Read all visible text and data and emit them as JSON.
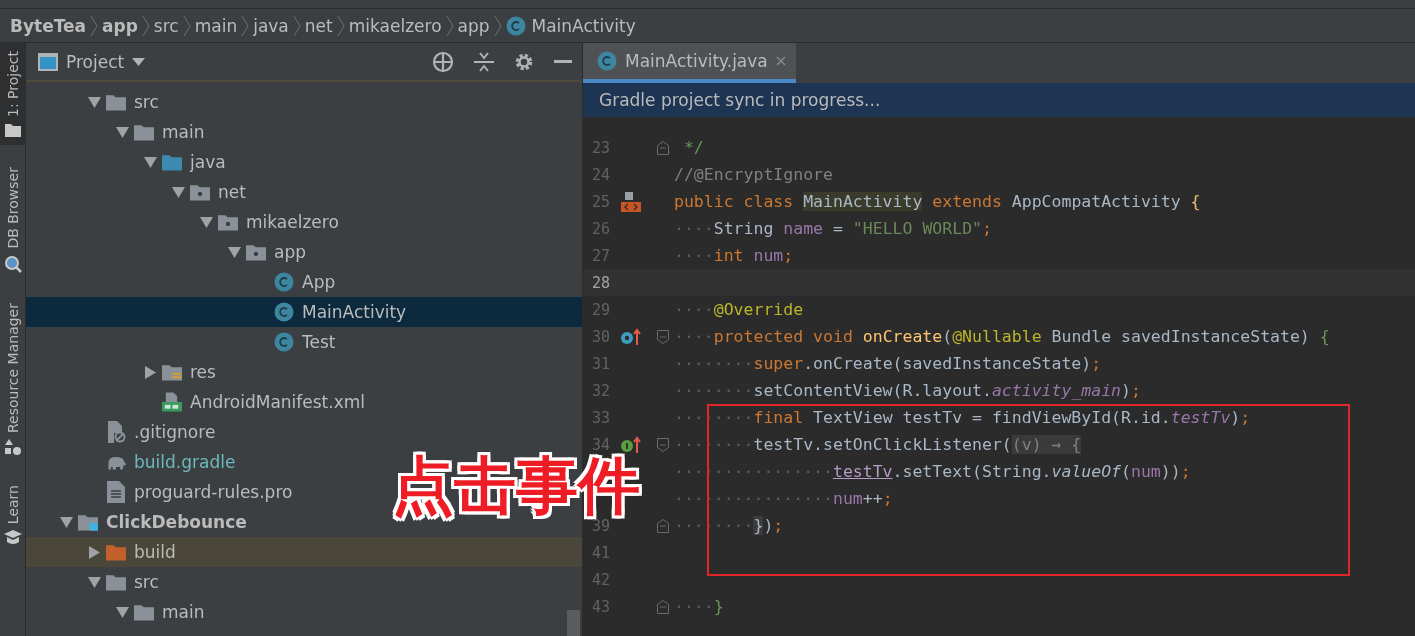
{
  "breadcrumb": [
    {
      "label": "ByteTea",
      "kind": "module"
    },
    {
      "label": "app",
      "kind": "module"
    },
    {
      "label": "src",
      "kind": "dir"
    },
    {
      "label": "main",
      "kind": "dir"
    },
    {
      "label": "java",
      "kind": "dir"
    },
    {
      "label": "net",
      "kind": "dir"
    },
    {
      "label": "mikaelzero",
      "kind": "dir"
    },
    {
      "label": "app",
      "kind": "dir"
    },
    {
      "label": "MainActivity",
      "kind": "class"
    }
  ],
  "tool_strip": [
    {
      "label": "1: Project",
      "kind": "project",
      "selected": true
    },
    {
      "label": "DB Browser",
      "kind": "db",
      "selected": false
    },
    {
      "label": "Resource Manager",
      "kind": "resources",
      "selected": false
    },
    {
      "label": "Learn",
      "kind": "learn",
      "selected": false
    }
  ],
  "project_panel": {
    "title": "Project",
    "tree": [
      {
        "children": [
          {
            "label": "src",
            "kind": "folder",
            "expanded": true,
            "selected": false,
            "children": [
              {
                "label": "main",
                "kind": "folder",
                "expanded": true,
                "selected": false,
                "children": [
                  {
                    "label": "java",
                    "kind": "source",
                    "expanded": true,
                    "selected": false,
                    "children": [
                      {
                        "label": "net",
                        "kind": "package",
                        "expanded": true,
                        "selected": false,
                        "children": [
                          {
                            "label": "mikaelzero",
                            "kind": "package",
                            "expanded": true,
                            "selected": false,
                            "children": [
                              {
                                "label": "app",
                                "kind": "package",
                                "expanded": true,
                                "selected": false,
                                "children": [
                                  {
                                    "label": "App",
                                    "kind": "class",
                                    "selected": false
                                  },
                                  {
                                    "label": "MainActivity",
                                    "kind": "class",
                                    "selected": true
                                  },
                                  {
                                    "label": "Test",
                                    "kind": "class",
                                    "selected": false
                                  }
                                ]
                              }
                            ]
                          }
                        ]
                      }
                    ]
                  },
                  {
                    "label": "res",
                    "kind": "res",
                    "expanded": false,
                    "selected": false
                  },
                  {
                    "label": "AndroidManifest.xml",
                    "kind": "manifest",
                    "selected": false
                  }
                ]
              }
            ]
          },
          {
            "label": ".gitignore",
            "kind": "ignore",
            "selected": false
          },
          {
            "label": "build.gradle",
            "kind": "gradle",
            "selected": false
          },
          {
            "label": "proguard-rules.pro",
            "kind": "file",
            "selected": false
          }
        ]
      },
      {
        "label": "ClickDebounce",
        "kind": "module",
        "expanded": true,
        "selected": false,
        "children": [
          {
            "label": "build",
            "kind": "excluded",
            "expanded": false,
            "selected": false
          },
          {
            "label": "src",
            "kind": "folder",
            "expanded": true,
            "selected": false,
            "children": [
              {
                "label": "main",
                "kind": "folder",
                "expanded": true,
                "selected": false
              }
            ]
          }
        ]
      }
    ]
  },
  "editor": {
    "tab": {
      "label": "MainActivity.java",
      "selected": true
    },
    "notification": "Gradle project sync in progress...",
    "lines": [
      {
        "number": "23",
        "fold": {
          "kind": "end"
        },
        "tokens": [
          {
            "text": " */",
            "kind": "doc"
          }
        ]
      },
      {
        "number": "24",
        "tokens": [
          {
            "text": "//@EncryptIgnore",
            "kind": "comment"
          }
        ]
      },
      {
        "number": "25",
        "gutter_icon": {
          "kind": "implemented"
        },
        "tokens": [
          {
            "text": "public class ",
            "kind": "keyword"
          },
          {
            "text": "MainActivity",
            "kind": "usage"
          },
          {
            "text": " extends",
            "kind": "keyword"
          },
          {
            "text": " AppCompatActivity ",
            "kind": "plain"
          },
          {
            "text": "{",
            "kind": "brace"
          }
        ]
      },
      {
        "number": "26",
        "tokens": [
          {
            "text": "····",
            "kind": "space"
          },
          {
            "text": "String ",
            "kind": "plain"
          },
          {
            "text": "name",
            "kind": "field"
          },
          {
            "text": " = ",
            "kind": "plain"
          },
          {
            "text": "\"HELLO WORLD\"",
            "kind": "string"
          },
          {
            "text": ";",
            "kind": "keyword"
          }
        ]
      },
      {
        "number": "27",
        "tokens": [
          {
            "text": "····",
            "kind": "space"
          },
          {
            "text": "int ",
            "kind": "keyword"
          },
          {
            "text": "num",
            "kind": "field"
          },
          {
            "text": ";",
            "kind": "keyword"
          }
        ]
      },
      {
        "number": "28",
        "current": true
      },
      {
        "number": "29",
        "tokens": [
          {
            "text": "····",
            "kind": "space"
          },
          {
            "text": "@Override",
            "kind": "annotation"
          }
        ]
      },
      {
        "number": "30",
        "gutter_icon": {
          "kind": "override"
        },
        "fold": {
          "kind": "start"
        },
        "tokens": [
          {
            "text": "····",
            "kind": "space"
          },
          {
            "text": "protected void ",
            "kind": "keyword"
          },
          {
            "text": "onCreate",
            "kind": "method"
          },
          {
            "text": "(",
            "kind": "plain"
          },
          {
            "text": "@Nullable",
            "kind": "annotation"
          },
          {
            "text": " Bundle savedInstanceState) ",
            "kind": "plain"
          },
          {
            "text": "{",
            "kind": "scope"
          }
        ]
      },
      {
        "number": "31",
        "tokens": [
          {
            "text": "········",
            "kind": "space"
          },
          {
            "text": "super",
            "kind": "keyword"
          },
          {
            "text": ".onCreate(savedInstanceState)",
            "kind": "plain"
          },
          {
            "text": ";",
            "kind": "keyword"
          }
        ]
      },
      {
        "number": "32",
        "tokens": [
          {
            "text": "········",
            "kind": "space"
          },
          {
            "text": "setContentView(R.layout.",
            "kind": "plain"
          },
          {
            "text": "activity_main",
            "kind": "static"
          },
          {
            "text": ")",
            "kind": "plain"
          },
          {
            "text": ";",
            "kind": "keyword"
          }
        ]
      },
      {
        "number": "33",
        "tokens": [
          {
            "text": "········",
            "kind": "space"
          },
          {
            "text": "final",
            "kind": "keyword"
          },
          {
            "text": " TextView testTv = findViewById(R.id.",
            "kind": "plain"
          },
          {
            "text": "testTv",
            "kind": "static"
          },
          {
            "text": ")",
            "kind": "plain"
          },
          {
            "text": ";",
            "kind": "keyword"
          }
        ]
      },
      {
        "number": "34",
        "gutter_icon": {
          "kind": "lambda"
        },
        "fold": {
          "kind": "start"
        },
        "tokens": [
          {
            "text": "········",
            "kind": "space"
          },
          {
            "text": "testTv.setOnClickListener(",
            "kind": "plain"
          },
          {
            "text": "(v) → {",
            "kind": "folded"
          }
        ]
      },
      {
        "tokens": [
          {
            "text": "················",
            "kind": "space"
          },
          {
            "text": "testTv",
            "kind": "captured"
          },
          {
            "text": ".setText(String.",
            "kind": "plain"
          },
          {
            "text": "valueOf",
            "kind": "italic"
          },
          {
            "text": "(",
            "kind": "plain"
          },
          {
            "text": "num",
            "kind": "field"
          },
          {
            "text": "))",
            "kind": "plain"
          },
          {
            "text": ";",
            "kind": "keyword"
          }
        ]
      },
      {
        "tokens": [
          {
            "text": "················",
            "kind": "space"
          },
          {
            "text": "num",
            "kind": "field"
          },
          {
            "text": "++",
            "kind": "plain"
          },
          {
            "text": ";",
            "kind": "keyword"
          }
        ]
      },
      {
        "number": "39",
        "fold": {
          "kind": "end"
        },
        "tokens": [
          {
            "text": "········",
            "kind": "space"
          },
          {
            "text": "}",
            "kind": "matched"
          },
          {
            "text": ")",
            "kind": "plain"
          },
          {
            "text": ";",
            "kind": "keyword"
          }
        ]
      },
      {
        "number": "41"
      },
      {
        "number": "42"
      },
      {
        "number": "43",
        "fold": {
          "kind": "end"
        },
        "tokens": [
          {
            "text": "····",
            "kind": "space"
          },
          {
            "text": "}",
            "kind": "scope"
          }
        ]
      }
    ]
  },
  "annotation": {
    "text": "点击事件"
  }
}
